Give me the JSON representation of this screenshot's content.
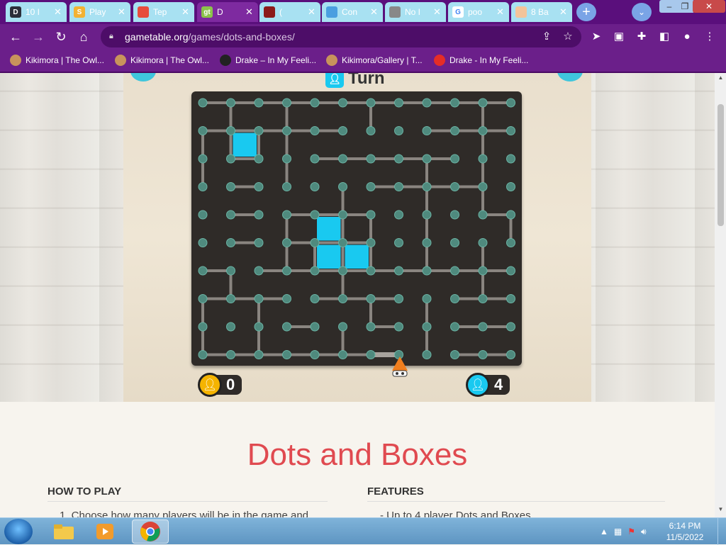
{
  "browser": {
    "tabs": [
      {
        "label": "10 I",
        "icon_color": "#2b2f3a",
        "icon_text": "D"
      },
      {
        "label": "Play",
        "icon_color": "#f2b233",
        "icon_text": "S"
      },
      {
        "label": "Tep",
        "icon_color": "#e74c3c",
        "icon_text": ""
      },
      {
        "label": "D",
        "icon_color": "#8bc34a",
        "icon_text": "gt",
        "active": true
      },
      {
        "label": "(",
        "icon_color": "#8b1a1a",
        "icon_text": ""
      },
      {
        "label": "Con",
        "icon_color": "#4a9fe0",
        "icon_text": ""
      },
      {
        "label": "No I",
        "icon_color": "#888",
        "icon_text": ""
      },
      {
        "label": "poo",
        "icon_color": "#fff",
        "icon_text": "G"
      },
      {
        "label": "8 Ba",
        "icon_color": "#f3c49a",
        "icon_text": ""
      }
    ],
    "url_domain": "gametable.org",
    "url_path": "/games/dots-and-boxes/",
    "bookmarks": [
      {
        "label": "Kikimora | The Owl...",
        "icon_color": "#c8935c"
      },
      {
        "label": "Kikimora | The Owl...",
        "icon_color": "#c8935c"
      },
      {
        "label": "Drake – In My Feeli...",
        "icon_color": "#222"
      },
      {
        "label": "Kikimora/Gallery | T...",
        "icon_color": "#c8935c"
      },
      {
        "label": "Drake - In My Feeli...",
        "icon_color": "#e52d27"
      }
    ],
    "accent": "#6b1f8a"
  },
  "game": {
    "turn_label": "Turn",
    "player1_score": "0",
    "player2_score": "4",
    "player1_color": "#f5b400",
    "player2_color": "#19c9f0",
    "grid_cols": 12,
    "grid_rows": 10,
    "filled_boxes": [
      [
        1,
        1
      ],
      [
        4,
        4
      ],
      [
        4,
        5
      ],
      [
        5,
        5
      ]
    ],
    "h_lines": [
      [
        0,
        0
      ],
      [
        0,
        1
      ],
      [
        0,
        2
      ],
      [
        0,
        3
      ],
      [
        0,
        4
      ],
      [
        0,
        5
      ],
      [
        0,
        6
      ],
      [
        0,
        7
      ],
      [
        0,
        8
      ],
      [
        0,
        9
      ],
      [
        0,
        10
      ],
      [
        1,
        0
      ],
      [
        1,
        1
      ],
      [
        1,
        2
      ],
      [
        1,
        3
      ],
      [
        1,
        4
      ],
      [
        1,
        8
      ],
      [
        1,
        9
      ],
      [
        1,
        10
      ],
      [
        2,
        1
      ],
      [
        2,
        4
      ],
      [
        2,
        5
      ],
      [
        2,
        6
      ],
      [
        2,
        7
      ],
      [
        2,
        8
      ],
      [
        3,
        1
      ],
      [
        3,
        6
      ],
      [
        3,
        7
      ],
      [
        3,
        8
      ],
      [
        3,
        9
      ],
      [
        4,
        1
      ],
      [
        4,
        3
      ],
      [
        4,
        4
      ],
      [
        4,
        5
      ],
      [
        4,
        10
      ],
      [
        5,
        1
      ],
      [
        5,
        3
      ],
      [
        5,
        4
      ],
      [
        5,
        5
      ],
      [
        6,
        0
      ],
      [
        6,
        2
      ],
      [
        6,
        3
      ],
      [
        6,
        4
      ],
      [
        6,
        5
      ],
      [
        6,
        6
      ],
      [
        6,
        7
      ],
      [
        6,
        8
      ],
      [
        6,
        9
      ],
      [
        6,
        10
      ],
      [
        7,
        0
      ],
      [
        7,
        1
      ],
      [
        7,
        2
      ],
      [
        7,
        4
      ],
      [
        7,
        5
      ],
      [
        7,
        6
      ],
      [
        7,
        9
      ],
      [
        7,
        10
      ],
      [
        8,
        3
      ],
      [
        8,
        6
      ],
      [
        8,
        9
      ],
      [
        8,
        10
      ],
      [
        9,
        0
      ],
      [
        9,
        1
      ],
      [
        9,
        2
      ],
      [
        9,
        3
      ],
      [
        9,
        4
      ],
      [
        9,
        5
      ],
      [
        9,
        6
      ],
      [
        9,
        9
      ],
      [
        9,
        10
      ]
    ],
    "v_lines": [
      [
        0,
        1
      ],
      [
        0,
        3
      ],
      [
        0,
        6
      ],
      [
        0,
        10
      ],
      [
        1,
        0
      ],
      [
        1,
        1
      ],
      [
        1,
        2
      ],
      [
        1,
        3
      ],
      [
        1,
        10
      ],
      [
        2,
        0
      ],
      [
        2,
        3
      ],
      [
        2,
        8
      ],
      [
        2,
        10
      ],
      [
        3,
        5
      ],
      [
        3,
        8
      ],
      [
        3,
        10
      ],
      [
        4,
        3
      ],
      [
        4,
        5
      ],
      [
        4,
        6
      ],
      [
        4,
        8
      ],
      [
        4,
        11
      ],
      [
        5,
        3
      ],
      [
        5,
        4
      ],
      [
        5,
        5
      ],
      [
        5,
        6
      ],
      [
        5,
        8
      ],
      [
        5,
        10
      ],
      [
        6,
        1
      ],
      [
        6,
        5
      ],
      [
        6,
        10
      ],
      [
        7,
        0
      ],
      [
        7,
        2
      ],
      [
        7,
        6
      ],
      [
        7,
        8
      ],
      [
        8,
        0
      ],
      [
        8,
        2
      ],
      [
        8,
        5
      ],
      [
        8,
        8
      ]
    ],
    "highlight_line": [
      9,
      6
    ]
  },
  "page": {
    "title": "Dots and Boxes",
    "how_to_play": "HOW TO PLAY",
    "features": "FEATURES",
    "how_first_item": "1.   Choose how many players will be in the game and",
    "features_first_item": "-    Up to 4 player Dots and Boxes"
  },
  "taskbar": {
    "time": "6:14 PM",
    "date": "11/5/2022"
  }
}
